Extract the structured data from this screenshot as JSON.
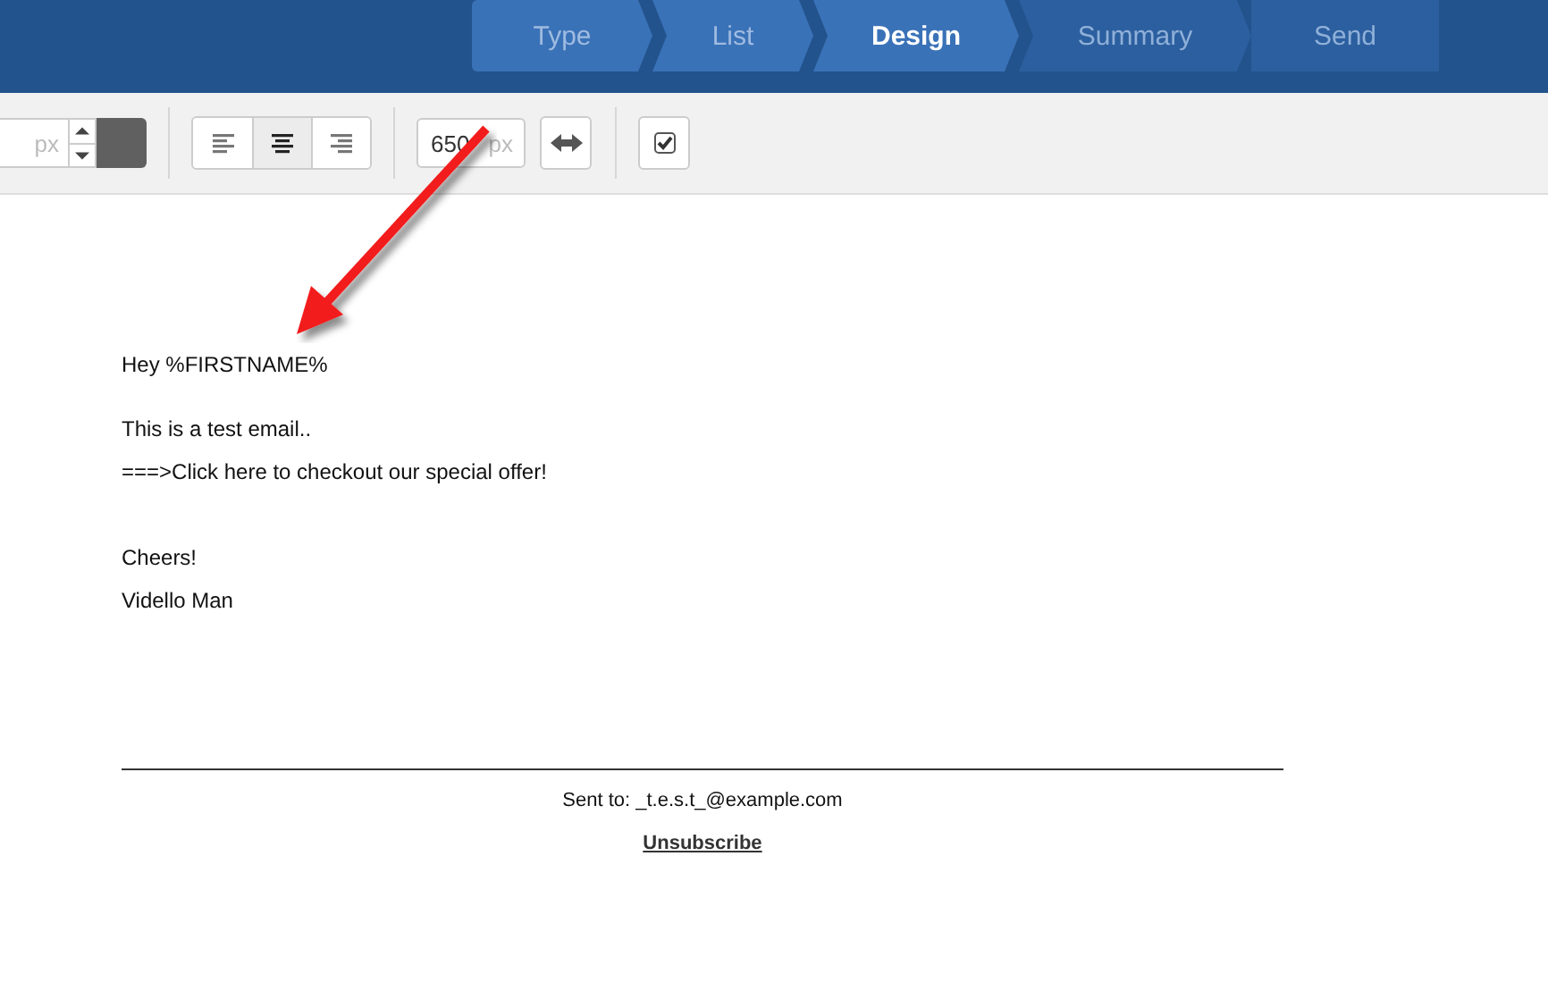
{
  "steps": [
    {
      "label": "Type",
      "selected": false,
      "done": true
    },
    {
      "label": "List",
      "selected": false,
      "done": true
    },
    {
      "label": "Design",
      "selected": true,
      "done": true
    },
    {
      "label": "Summary",
      "selected": false,
      "done": false
    },
    {
      "label": "Send",
      "selected": false,
      "done": false
    }
  ],
  "toolbar": {
    "size_field": {
      "placeholder": "px"
    },
    "align_buttons": [
      {
        "kind": "left",
        "selected": false
      },
      {
        "kind": "center",
        "selected": true
      },
      {
        "kind": "right",
        "selected": false
      }
    ],
    "width_field": {
      "value": "650",
      "placeholder": "px"
    },
    "checkbox": {
      "checked": true
    }
  },
  "email": {
    "greeting": "Hey %FIRSTNAME%",
    "lines": [
      "This is a test email..",
      "===>Click here to checkout our special offer!"
    ],
    "closing": [
      "Cheers!",
      "Vidello Man"
    ],
    "footer": {
      "sent_to": "Sent to: _t.e.s.t_@example.com",
      "unsubscribe": "Unsubscribe"
    }
  }
}
